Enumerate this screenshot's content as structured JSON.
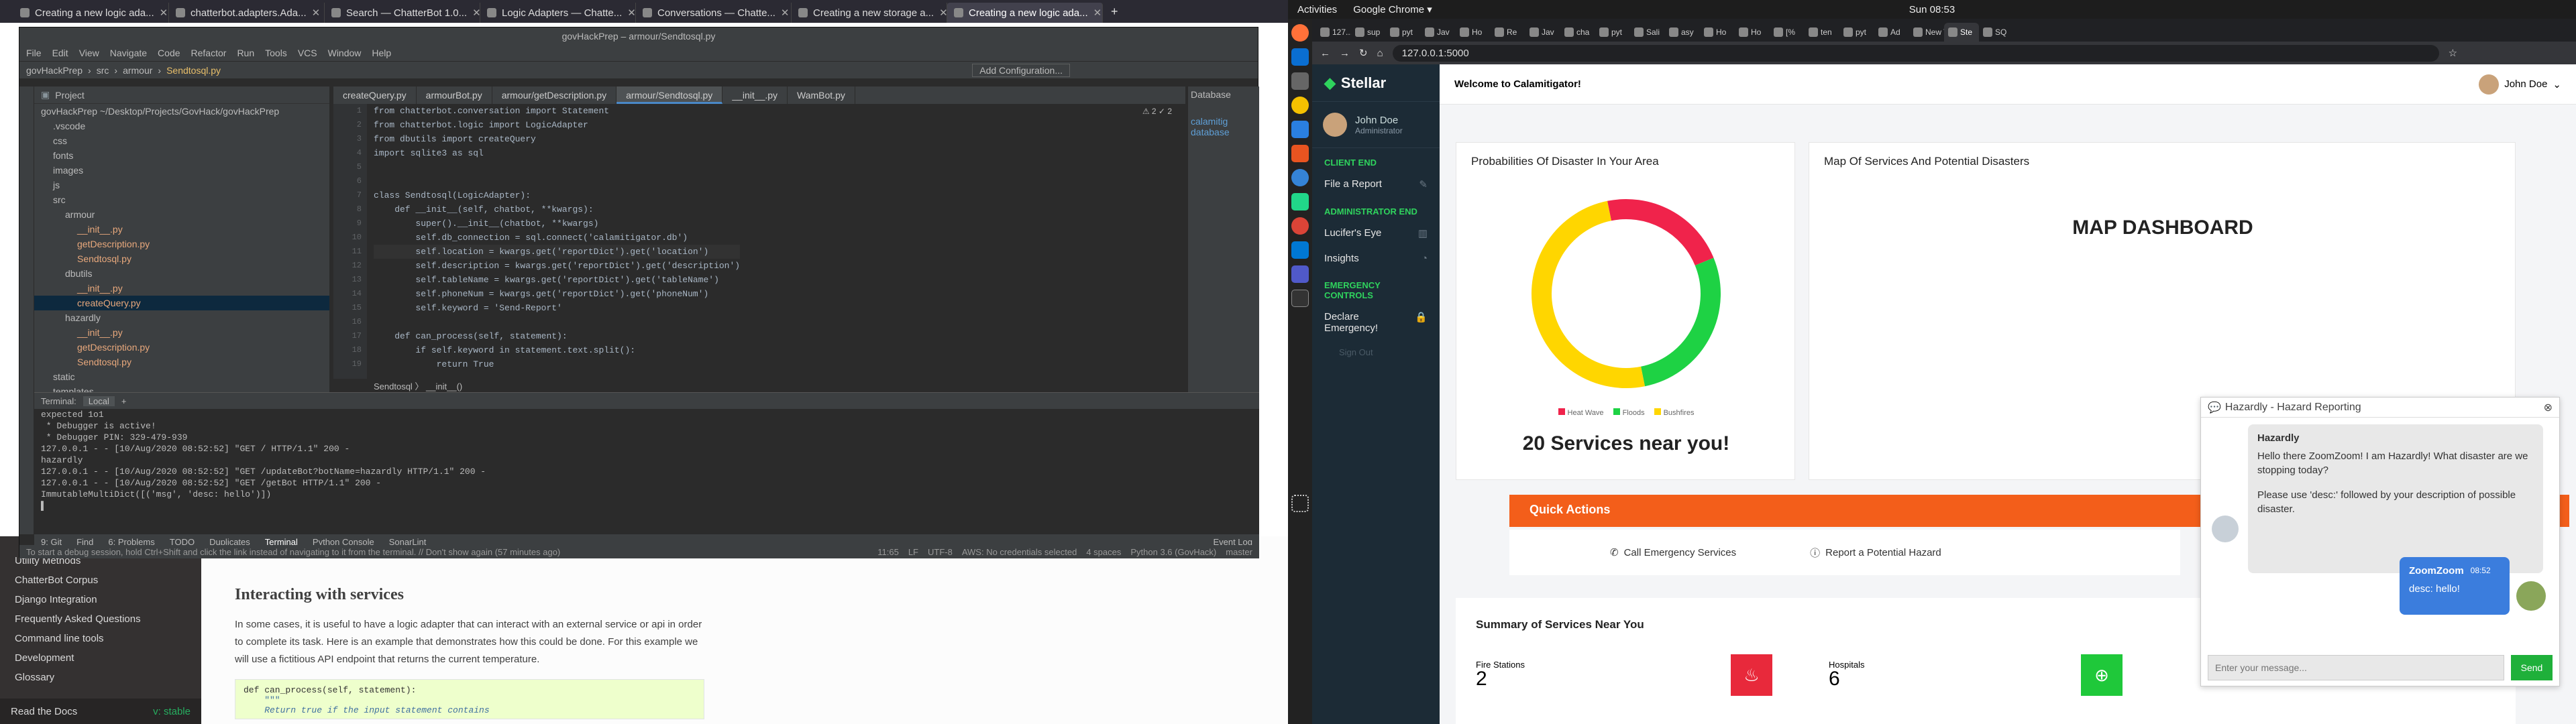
{
  "left_browser": {
    "tabs": [
      {
        "label": "Creating a new logic ada..."
      },
      {
        "label": "chatterbot.adapters.Ada..."
      },
      {
        "label": "Search — ChatterBot 1.0..."
      },
      {
        "label": "Logic Adapters — Chatte..."
      },
      {
        "label": "Conversations — Chatte..."
      },
      {
        "label": "Creating a new storage a..."
      },
      {
        "label": "Creating a new logic ada..."
      }
    ],
    "new_tab": "+"
  },
  "docs": {
    "sidebar": [
      "Utility Methods",
      "ChatterBot Corpus",
      "Django Integration",
      "Frequently Asked Questions",
      "Command line tools",
      "Development",
      "Glossary"
    ],
    "read_docs": "Read the Docs",
    "version": "v: stable",
    "heading": "Interacting with services",
    "para": "In some cases, it is useful to have a logic adapter that can interact with an external service or api in order to complete its task. Here is an example that demonstrates how this could be done. For this example we will use a fictitious API endpoint that returns the current temperature.",
    "code": [
      "def can_process(self, statement):",
      "    \"\"\"",
      "    Return true if the input statement contains"
    ]
  },
  "ide": {
    "title": "govHackPrep – armour/Sendtosql.py",
    "menu": [
      "File",
      "Edit",
      "View",
      "Navigate",
      "Code",
      "Refactor",
      "Run",
      "Tools",
      "VCS",
      "Window",
      "Help"
    ],
    "breadcrumb": [
      "govHackPrep",
      "src",
      "armour",
      "Sendtosql.py"
    ],
    "add_config": "Add Configuration...",
    "git": "Git:",
    "project_label": "Project",
    "tree": [
      {
        "t": "govHackPrep ~/Desktop/Projects/GovHack/govHackPrep",
        "d": 0
      },
      {
        "t": ".vscode",
        "d": 1
      },
      {
        "t": "css",
        "d": 1
      },
      {
        "t": "fonts",
        "d": 1
      },
      {
        "t": "images",
        "d": 1
      },
      {
        "t": "js",
        "d": 1
      },
      {
        "t": "src",
        "d": 1
      },
      {
        "t": "armour",
        "d": 2
      },
      {
        "t": "__init__.py",
        "d": 3
      },
      {
        "t": "getDescription.py",
        "d": 3
      },
      {
        "t": "Sendtosql.py",
        "d": 3
      },
      {
        "t": "dbutils",
        "d": 2
      },
      {
        "t": "__init__.py",
        "d": 3
      },
      {
        "t": "createQuery.py",
        "d": 3
      },
      {
        "t": "hazardly",
        "d": 2
      },
      {
        "t": "__init__.py",
        "d": 3
      },
      {
        "t": "getDescription.py",
        "d": 3
      },
      {
        "t": "Sendtosql.py",
        "d": 3
      },
      {
        "t": "static",
        "d": 1
      },
      {
        "t": "templates",
        "d": 1
      }
    ],
    "editor_tabs": [
      "createQuery.py",
      "armourBot.py",
      "armour/getDescription.py",
      "armour/Sendtosql.py",
      "__init__.py",
      "WamBot.py"
    ],
    "warnings": "⚠ 2  ✓ 2",
    "code_lines": [
      "from chatterbot.conversation import Statement",
      "from chatterbot.logic import LogicAdapter",
      "from dbutils import createQuery",
      "import sqlite3 as sql",
      "",
      "",
      "class Sendtosql(LogicAdapter):",
      "    def __init__(self, chatbot, **kwargs):",
      "        super().__init__(chatbot, **kwargs)",
      "        self.db_connection = sql.connect('calamitigator.db')",
      "        self.location = kwargs.get('reportDict').get('location')",
      "        self.description = kwargs.get('reportDict').get('description')",
      "        self.tableName = kwargs.get('reportDict').get('tableName')",
      "        self.phoneNum = kwargs.get('reportDict').get('phoneNum')",
      "        self.keyword = 'Send-Report'",
      "",
      "    def can_process(self, statement):",
      "        if self.keyword in statement.text.split():",
      "            return True"
    ],
    "line_numbers": [
      "1",
      "2",
      "3",
      "4",
      "5",
      "6",
      "7",
      "8",
      "9",
      "10",
      "11",
      "12",
      "13",
      "14",
      "15",
      "16",
      "17",
      "18",
      "19"
    ],
    "editor_breadcrumb": "Sendtosql  〉 __init__()",
    "db_panel": {
      "title": "Database",
      "items": [
        "calamitig",
        "database"
      ]
    },
    "terminal": {
      "label": "Terminal:",
      "tab": "Local",
      "lines": [
        "expected 1o1",
        " * Debugger is active!",
        " * Debugger PIN: 329-479-939",
        "127.0.0.1 - - [10/Aug/2020 08:52:52] \"GET / HTTP/1.1\" 200 -",
        "hazardly",
        "127.0.0.1 - - [10/Aug/2020 08:52:52] \"GET /updateBot?botName=hazardly HTTP/1.1\" 200 -",
        "127.0.0.1 - - [10/Aug/2020 08:52:52] \"GET /getBot HTTP/1.1\" 200 -",
        "ImmutableMultiDict([('msg', 'desc: hello')])",
        "▌"
      ]
    },
    "tool_tabs": [
      "9: Git",
      "Find",
      "6: Problems",
      "TODO",
      "Duplicates",
      "Terminal",
      "Python Console",
      "SonarLint"
    ],
    "event_log": "Event Log",
    "status_msg": "To start a debug session, hold Ctrl+Shift and click the link instead of navigating to it from the terminal. // Don't show again (57 minutes ago)",
    "status_right": [
      "11:65",
      "LF",
      "UTF-8",
      "AWS: No credentials selected",
      "4 spaces",
      "Python 3.6 (GovHack)",
      "master"
    ]
  },
  "ubuntu": {
    "activities": "Activities",
    "app": "Google Chrome ▾",
    "clock": "Sun 08:53"
  },
  "chrome": {
    "tabs": [
      "127...",
      "sup",
      "pyt",
      "Jav",
      "Ho",
      "Re",
      "Jav",
      "cha",
      "pyt",
      "Sali",
      "asy",
      "Ho",
      "Ho",
      "[%",
      "ten",
      "pyt",
      "Ad",
      "New Ta",
      "Ste",
      "SQ"
    ],
    "url": "127.0.0.1:5000"
  },
  "app": {
    "brand": "Stellar",
    "user_name": "John Doe",
    "user_role": "Administrator",
    "welcome": "Welcome to Calamitigator!",
    "header_user": "John Doe",
    "nav": [
      {
        "type": "section",
        "label": "CLIENT END"
      },
      {
        "type": "item",
        "label": "File a Report",
        "icon": "edit-icon"
      },
      {
        "type": "section",
        "label": "ADMINISTRATOR END"
      },
      {
        "type": "item",
        "label": "Lucifer's Eye",
        "icon": "columns-icon"
      },
      {
        "type": "item",
        "label": "Insights",
        "icon": "pie-icon"
      },
      {
        "type": "section",
        "label": "EMERGENCY CONTROLS"
      },
      {
        "type": "item",
        "label": "Declare Emergency!",
        "icon": "lock-icon"
      }
    ],
    "sign_out": "Sign Out",
    "prob_card": {
      "title": "Probabilities Of Disaster In Your Area",
      "services_text": "20 Services near you!"
    },
    "map_card": {
      "title": "Map Of Services And Potential Disasters",
      "dashboard": "MAP DASHBOARD"
    },
    "quick_actions": {
      "title": "Quick Actions",
      "actions": [
        "Call Emergency Services",
        "Report a Potential Hazard"
      ]
    },
    "summary": {
      "title": "Summary of Services Near You",
      "items": [
        {
          "label": "Fire Stations",
          "value": "2",
          "color": "#e8293b"
        },
        {
          "label": "Hospitals",
          "value": "6",
          "color": "#1fc83a"
        }
      ]
    },
    "chat": {
      "title": "Hazardly - Hazard Reporting",
      "bot_name": "Hazardly",
      "bot_msg1": "Hello there ZoomZoom! I am Hazardly! What disaster are we stopping today?",
      "bot_msg2": "Please use 'desc:' followed by your description of possible disaster.",
      "user_name": "ZoomZoom",
      "user_time": "08:52",
      "user_msg": "desc: hello!",
      "input_placeholder": "Enter your message...",
      "send": "Send"
    }
  },
  "chart_data": {
    "type": "pie",
    "title": "Probabilities Of Disaster In Your Area",
    "categories": [
      "Heat Wave",
      "Floods",
      "Bushfires"
    ],
    "values": [
      22,
      28,
      50
    ],
    "colors": [
      "#f0234b",
      "#1ed244",
      "#ffd600"
    ]
  }
}
